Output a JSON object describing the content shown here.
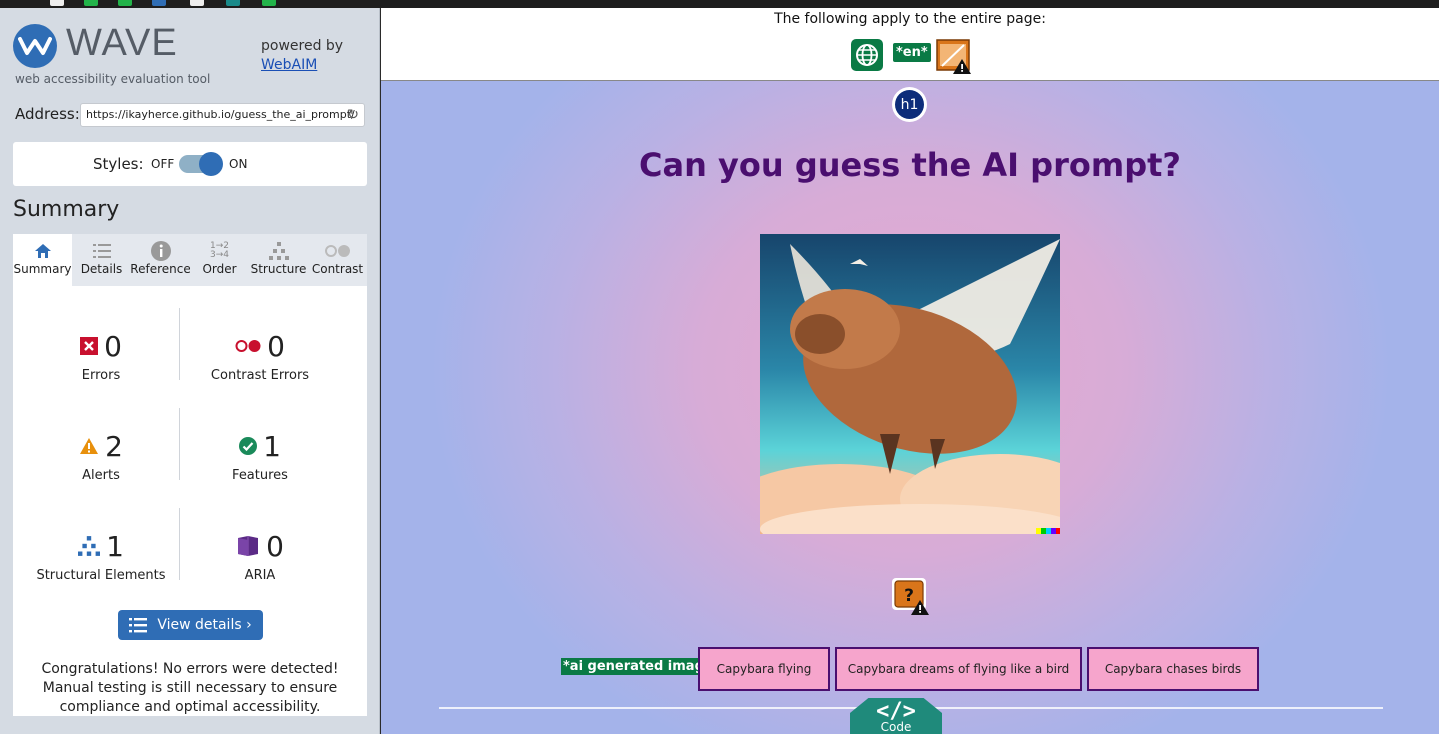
{
  "wave": {
    "logo_text": "WAVE",
    "tagline": "web accessibility evaluation tool",
    "powered_by": "powered by",
    "webaim_link": "WebAIM",
    "address_label": "Address:",
    "address_value": "https://ikayherce.github.io/guess_the_ai_prompt/",
    "styles_label": "Styles:",
    "styles_off": "OFF",
    "styles_on": "ON",
    "summary_title": "Summary",
    "tabs": [
      {
        "label": "Summary",
        "icon": "home-icon",
        "active": true
      },
      {
        "label": "Details",
        "icon": "list-icon"
      },
      {
        "label": "Reference",
        "icon": "info-icon"
      },
      {
        "label": "Order",
        "icon": "order-icon"
      },
      {
        "label": "Structure",
        "icon": "structure-icon"
      },
      {
        "label": "Contrast",
        "icon": "contrast-icon"
      }
    ],
    "stats": {
      "errors": {
        "count": "0",
        "label": "Errors",
        "color": "#c8102e"
      },
      "contrast_errors": {
        "count": "0",
        "label": "Contrast Errors",
        "color": "#c8102e"
      },
      "alerts": {
        "count": "2",
        "label": "Alerts",
        "color": "#e8900c"
      },
      "features": {
        "count": "1",
        "label": "Features",
        "color": "#1a8a5a"
      },
      "structural": {
        "count": "1",
        "label": "Structural Elements",
        "color": "#2f6db5"
      },
      "aria": {
        "count": "0",
        "label": "ARIA",
        "color": "#5b2a86"
      }
    },
    "view_details": "View details ›",
    "congrats": "Congratulations! No errors were detected! Manual testing is still necessary to ensure compliance and optimal accessibility."
  },
  "page": {
    "whole_page_text": "The following apply to the entire page:",
    "lang_badge": "*en*",
    "h1_badge": "h1",
    "heading": "Can you guess the AI prompt?",
    "ai_label": "*ai generated image*",
    "choices": [
      "Capybara flying",
      "Capybara dreams of flying like a bird",
      "Capybara chases birds"
    ],
    "code_button": "Code",
    "code_glyph": "</>"
  },
  "colors": {
    "accent": "#2f6db5",
    "heading": "#4a0f6f",
    "choice_bg": "#f6a5cc",
    "feature_green": "#0a7a45"
  }
}
